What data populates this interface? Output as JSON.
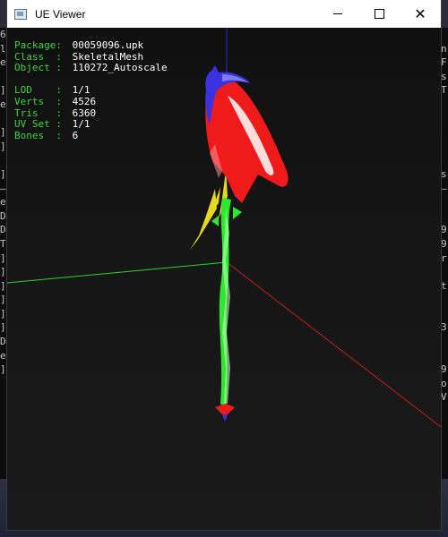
{
  "window": {
    "title": "UE Viewer",
    "controls": {
      "minimize": "minimize",
      "maximize": "maximize",
      "close": "✕"
    }
  },
  "info": {
    "package": {
      "label": "Package:",
      "value": "00059096.upk"
    },
    "class": {
      "label": "Class  :",
      "value": "SkeletalMesh"
    },
    "object": {
      "label": "Object :",
      "value": "110272_Autoscale"
    },
    "lod": {
      "label": "LOD    :",
      "value": "1/1"
    },
    "verts": {
      "label": "Verts  :",
      "value": "4526"
    },
    "tris": {
      "label": "Tris   :",
      "value": "6360"
    },
    "uvset": {
      "label": "UV Set :",
      "value": "1/1"
    },
    "bones": {
      "label": "Bones  :",
      "value": "6"
    }
  },
  "colors": {
    "label_green": "#3cd63c",
    "value_white": "#ffffff",
    "axis_x": "#c41e1e",
    "axis_y": "#2fd12f",
    "axis_z": "#2a2ad6",
    "mesh_red": "#ef1a1a",
    "mesh_blue": "#3a32e0",
    "mesh_green": "#2ee82e",
    "mesh_yellow": "#e6d81a"
  },
  "background_console": {
    "left_chars": [
      "6",
      "l",
      "e",
      "",
      "]",
      "e",
      "",
      "]",
      "]",
      "",
      "]",
      "—",
      "e",
      "D",
      "D",
      "T",
      "]",
      "]",
      "]",
      "]",
      "]",
      "]",
      "D",
      "e",
      "]"
    ],
    "right_chars": [
      "",
      "n",
      "F",
      "s",
      "T",
      "",
      "",
      "",
      "",
      "",
      "s",
      "—",
      "",
      "",
      "9",
      "9",
      "r",
      "",
      "t",
      "",
      "",
      "3",
      "",
      "",
      "9",
      "o",
      "V",
      ""
    ]
  }
}
